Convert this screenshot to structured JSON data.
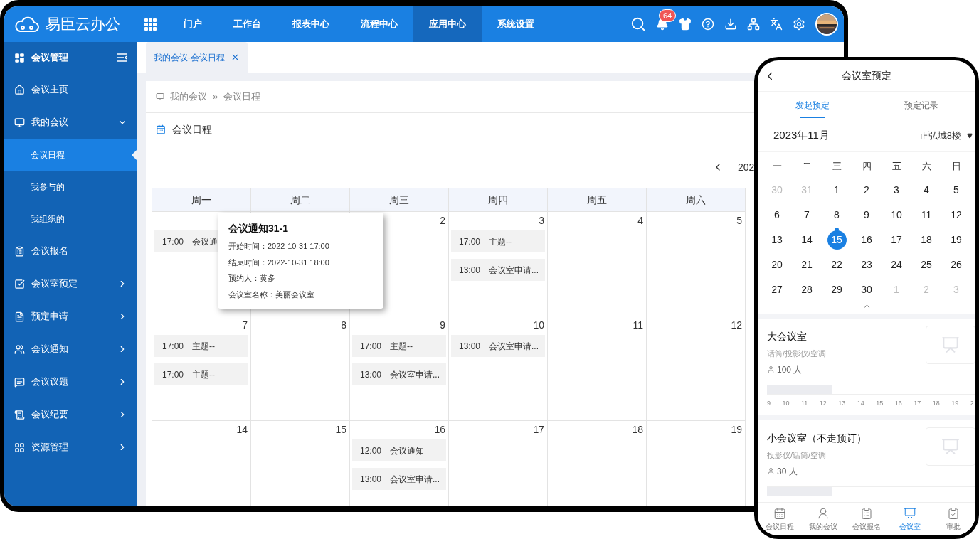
{
  "app": {
    "logo_text": "易臣云办公"
  },
  "top_nav": [
    {
      "label": "门户",
      "selected": false
    },
    {
      "label": "工作台",
      "selected": false
    },
    {
      "label": "报表中心",
      "selected": false
    },
    {
      "label": "流程中心",
      "selected": false
    },
    {
      "label": "应用中心",
      "selected": true
    },
    {
      "label": "系统设置",
      "selected": false
    }
  ],
  "notifications": {
    "badge": "64"
  },
  "sidebar": {
    "title": "会议管理",
    "items": [
      {
        "label": "会议主页",
        "kind": "link"
      },
      {
        "label": "我的会议",
        "kind": "group",
        "expanded": true,
        "children": [
          {
            "label": "会议日程",
            "selected": true
          },
          {
            "label": "我参与的",
            "selected": false
          },
          {
            "label": "我组织的",
            "selected": false
          }
        ]
      },
      {
        "label": "会议报名",
        "kind": "link"
      },
      {
        "label": "会议室预定",
        "kind": "group",
        "expanded": false
      },
      {
        "label": "预定申请",
        "kind": "group",
        "expanded": false
      },
      {
        "label": "会议通知",
        "kind": "group",
        "expanded": false
      },
      {
        "label": "会议议题",
        "kind": "group",
        "expanded": false
      },
      {
        "label": "会议纪要",
        "kind": "group",
        "expanded": false
      },
      {
        "label": "资源管理",
        "kind": "group",
        "expanded": false
      }
    ]
  },
  "tabs": [
    {
      "label": "我的会议-会议日程",
      "selected": true
    }
  ],
  "breadcrumb": [
    "我的会议",
    "会议日程"
  ],
  "breadcrumb_separator": "»",
  "panel": {
    "title": "会议日程"
  },
  "calendar": {
    "period": "202",
    "weekdays": [
      "周一",
      "周二",
      "周三",
      "周四",
      "周五",
      "周六"
    ],
    "weeks": [
      [
        {
          "events": [
            {
              "time": "17:00",
              "title": "会议通"
            }
          ]
        },
        {
          "date": "2"
        },
        {
          "date": "3",
          "events": [
            {
              "time": "17:00",
              "title": "主题--"
            },
            {
              "time": "13:00",
              "title": "会议室申请..."
            }
          ]
        },
        {
          "date": "4"
        },
        {
          "date": "5"
        }
      ],
      [
        {
          "date": "7",
          "events": [
            {
              "time": "17:00",
              "title": "主题--"
            },
            {
              "time": "17:00",
              "title": "主题--"
            }
          ]
        },
        {
          "date": "8"
        },
        {
          "date": "9",
          "events": [
            {
              "time": "17:00",
              "title": "主题--"
            },
            {
              "time": "13:00",
              "title": "会议室申请..."
            }
          ]
        },
        {
          "date": "10",
          "events": [
            {
              "time": "13:00",
              "title": "会议室申请..."
            }
          ]
        },
        {
          "date": "11"
        },
        {
          "date": "12"
        }
      ],
      [
        {
          "date": "14"
        },
        {
          "date": "15"
        },
        {
          "date": "16",
          "events": [
            {
              "time": "12:00",
              "title": "会议通知"
            },
            {
              "time": "13:00",
              "title": "会议室申请..."
            }
          ]
        },
        {
          "date": "17"
        },
        {
          "date": "18"
        },
        {
          "date": "19"
        }
      ]
    ]
  },
  "tooltip": {
    "title": "会议通知31-1",
    "lines": [
      "开始时间：2022-10-31 17:00",
      "结束时间：2022-10-31 18:00",
      "预约人：黄多",
      "会议室名称：美丽会议室"
    ]
  },
  "phone": {
    "title": "会议室预定",
    "tabs": [
      {
        "label": "发起预定",
        "selected": true
      },
      {
        "label": "预定记录",
        "selected": false
      }
    ],
    "month": "2023年11月",
    "location": "正弘城8楼",
    "weekdays": [
      "一",
      "二",
      "三",
      "四",
      "五",
      "六",
      "日"
    ],
    "weeks": [
      [
        {
          "label": "30",
          "muted": true,
          "selected": false,
          "marked": false
        },
        {
          "label": "31",
          "muted": true,
          "selected": false,
          "marked": false
        },
        {
          "label": "1",
          "muted": false,
          "selected": false,
          "marked": false
        },
        {
          "label": "2",
          "muted": false,
          "selected": false,
          "marked": false
        },
        {
          "label": "3",
          "muted": false,
          "selected": false,
          "marked": false
        },
        {
          "label": "4",
          "muted": false,
          "selected": false,
          "marked": false
        },
        {
          "label": "5",
          "muted": false,
          "selected": false,
          "marked": false
        }
      ],
      [
        {
          "label": "6",
          "muted": false,
          "selected": false,
          "marked": false
        },
        {
          "label": "7",
          "muted": false,
          "selected": false,
          "marked": false
        },
        {
          "label": "8",
          "muted": false,
          "selected": false,
          "marked": false
        },
        {
          "label": "9",
          "muted": false,
          "selected": false,
          "marked": false
        },
        {
          "label": "10",
          "muted": false,
          "selected": false,
          "marked": false
        },
        {
          "label": "11",
          "muted": false,
          "selected": false,
          "marked": false
        },
        {
          "label": "12",
          "muted": false,
          "selected": false,
          "marked": false
        }
      ],
      [
        {
          "label": "13",
          "muted": false,
          "selected": false,
          "marked": false
        },
        {
          "label": "14",
          "muted": false,
          "selected": false,
          "marked": false
        },
        {
          "label": "15",
          "muted": false,
          "selected": true,
          "marked": true
        },
        {
          "label": "16",
          "muted": false,
          "selected": false,
          "marked": false
        },
        {
          "label": "17",
          "muted": false,
          "selected": false,
          "marked": false
        },
        {
          "label": "18",
          "muted": false,
          "selected": false,
          "marked": false
        },
        {
          "label": "19",
          "muted": false,
          "selected": false,
          "marked": false
        }
      ],
      [
        {
          "label": "20",
          "muted": false,
          "selected": false,
          "marked": false
        },
        {
          "label": "21",
          "muted": false,
          "selected": false,
          "marked": false
        },
        {
          "label": "22",
          "muted": false,
          "selected": false,
          "marked": false
        },
        {
          "label": "23",
          "muted": false,
          "selected": false,
          "marked": false
        },
        {
          "label": "24",
          "muted": false,
          "selected": false,
          "marked": false
        },
        {
          "label": "25",
          "muted": false,
          "selected": false,
          "marked": false
        },
        {
          "label": "26",
          "muted": false,
          "selected": false,
          "marked": false
        }
      ],
      [
        {
          "label": "27",
          "muted": false,
          "selected": false,
          "marked": false
        },
        {
          "label": "28",
          "muted": false,
          "selected": false,
          "marked": false
        },
        {
          "label": "29",
          "muted": false,
          "selected": false,
          "marked": false
        },
        {
          "label": "30",
          "muted": false,
          "selected": false,
          "marked": false
        },
        {
          "label": "1",
          "muted": true,
          "selected": false,
          "marked": false
        },
        {
          "label": "2",
          "muted": true,
          "selected": false,
          "marked": false
        },
        {
          "label": "3",
          "muted": true,
          "selected": false,
          "marked": false
        }
      ]
    ],
    "rooms": [
      {
        "name": "大会议室",
        "equipment": "话筒/投影仪/空调",
        "capacity": "100 人",
        "level": 0.31,
        "hours": [
          "9",
          "10",
          "11",
          "12",
          "13",
          "14",
          "15",
          "16",
          "17",
          "18",
          "19",
          "2"
        ]
      },
      {
        "name": "小会议室（不走预订）",
        "equipment": "投影仪/话筒/空调",
        "capacity": "30 人",
        "level": 0.31
      }
    ],
    "bottom_nav": [
      {
        "label": "会议日程",
        "selected": false
      },
      {
        "label": "我的会议",
        "selected": false
      },
      {
        "label": "会议报名",
        "selected": false
      },
      {
        "label": "会议室",
        "selected": true
      },
      {
        "label": "审批",
        "selected": false
      }
    ]
  }
}
